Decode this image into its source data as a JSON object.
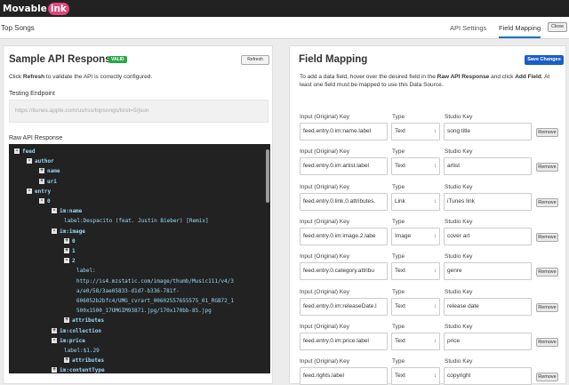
{
  "app": {
    "logo_main": "Movable",
    "logo_accent": "ink"
  },
  "header": {
    "title": "Top Songs",
    "tabs": [
      {
        "label": "API Settings"
      },
      {
        "label": "Field Mapping"
      }
    ],
    "close_label": "Close"
  },
  "left": {
    "title": "Sample API Response",
    "badge": "VALID",
    "refresh_label": "Refresh",
    "instruction_pre": "Click ",
    "instruction_bold": "Refresh",
    "instruction_post": " to validate the API is correctly configured.",
    "endpoint_label": "Testing Endpoint",
    "endpoint_value": "https://itunes.apple.com/us/rss/topsongs/limit=5/json",
    "raw_label": "Raw API Response",
    "tree": [
      {
        "toggle": "-",
        "text": "feed"
      },
      {
        "toggle": "-",
        "text": "author"
      },
      {
        "toggle": "+",
        "text": "name"
      },
      {
        "toggle": "+",
        "text": "uri"
      },
      {
        "toggle": "-",
        "text": "entry"
      },
      {
        "toggle": "-",
        "text": "0"
      },
      {
        "toggle": "-",
        "text": "im:name"
      },
      {
        "toggle": "",
        "text": "label:Despacito (feat. Justin Bieber) [Remix]"
      },
      {
        "toggle": "-",
        "text": "im:image"
      },
      {
        "toggle": "+",
        "text": "0"
      },
      {
        "toggle": "+",
        "text": "1"
      },
      {
        "toggle": "-",
        "text": "2"
      },
      {
        "toggle": "",
        "text": "label:"
      },
      {
        "toggle": "",
        "text": "http://is4.mzstatic.com/image/thumb/Music111/v4/3"
      },
      {
        "toggle": "",
        "text": "a/e0/58/3ae05833-d1d7-b336-781f-"
      },
      {
        "toggle": "",
        "text": "606052b2bfc4/UMG_cvrart_00602557655575_01_RGB72_1"
      },
      {
        "toggle": "",
        "text": "500x1500_17UMGIM93871.jpg/170x170bb-85.jpg"
      },
      {
        "toggle": "+",
        "text": "attributes"
      },
      {
        "toggle": "+",
        "text": "im:collection"
      },
      {
        "toggle": "-",
        "text": "im:price"
      },
      {
        "toggle": "",
        "text": "label:$1.29"
      },
      {
        "toggle": "+",
        "text": "attributes"
      },
      {
        "toggle": "+",
        "text": "im:contentType"
      }
    ]
  },
  "right": {
    "title": "Field Mapping",
    "save_label": "Save Changes",
    "desc_1": "To add a data field, hover over the desired field in the ",
    "desc_b1": "Raw API Response",
    "desc_2": " and click ",
    "desc_b2": "Add Field",
    "desc_3": ". At least one field must be mapped to use this Data Source.",
    "col_input": "Input (Original) Key",
    "col_type": "Type",
    "col_studio": "Studio Key",
    "remove_label": "Remove",
    "rows": [
      {
        "input": "feed.entry.0.im:name.label",
        "type": "Text",
        "studio": "song title"
      },
      {
        "input": "feed.entry.0.im:artist.label",
        "type": "Text",
        "studio": "artist"
      },
      {
        "input": "feed.entry.0.link.0.attributes.",
        "type": "Link",
        "studio": "iTunes link"
      },
      {
        "input": "feed.entry.0.im:image.2.labe",
        "type": "Image",
        "studio": "cover art"
      },
      {
        "input": "feed.entry.0.category.attribu",
        "type": "Text",
        "studio": "genre"
      },
      {
        "input": "feed.entry.0.im:releaseDate.l",
        "type": "Text",
        "studio": "release date"
      },
      {
        "input": "feed.entry.0.im:price.label",
        "type": "Text",
        "studio": "price"
      },
      {
        "input": "feed.rights.label",
        "type": "Text",
        "studio": "copyright"
      }
    ]
  }
}
